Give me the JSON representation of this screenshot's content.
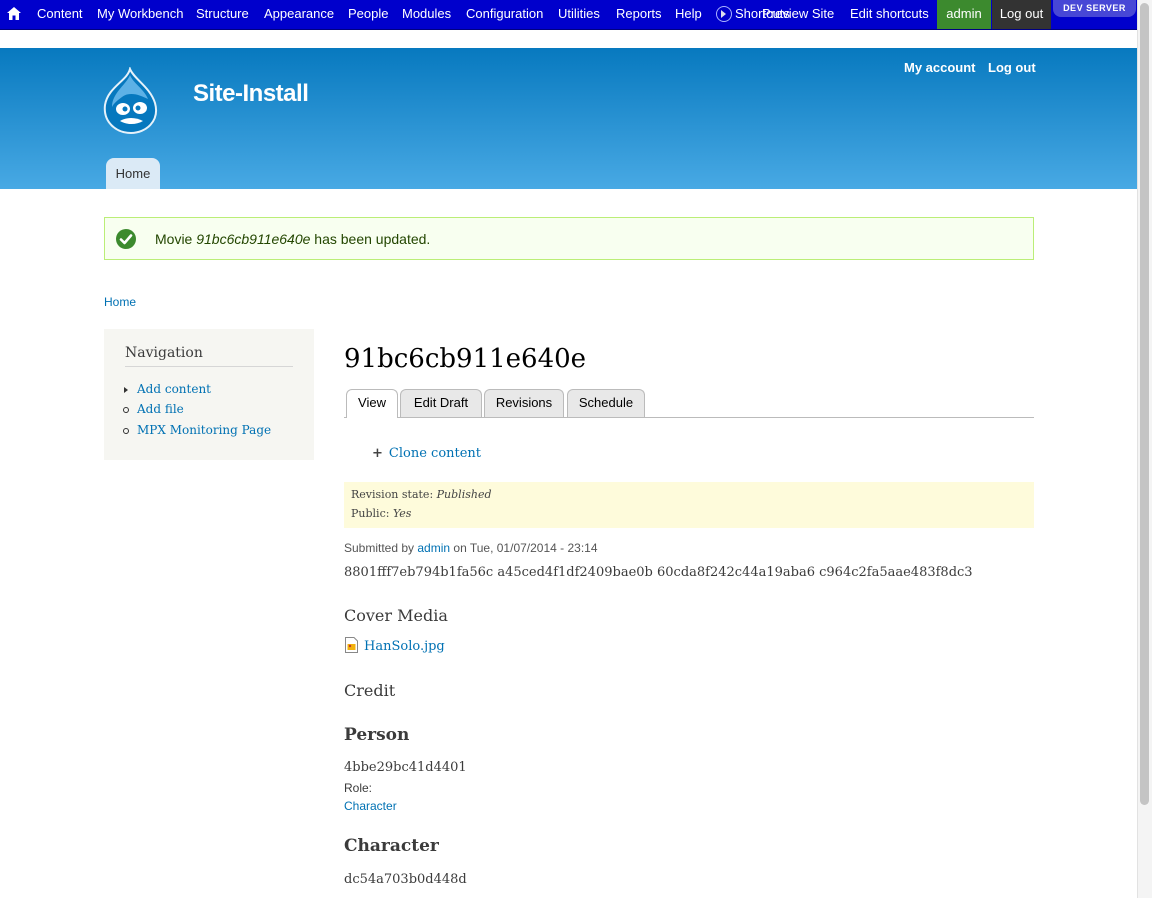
{
  "toolbar": {
    "items": [
      "Content",
      "My Workbench",
      "Structure",
      "Appearance",
      "People",
      "Modules",
      "Configuration",
      "Utilities",
      "Reports",
      "Help"
    ],
    "shortcuts_label": "Shortcuts",
    "preview_label": "Preview Site",
    "edit_shortcuts_label": "Edit shortcuts",
    "user_label": "admin",
    "logout_label": "Log out",
    "dev_badge": "DEV SERVER"
  },
  "header": {
    "site_name": "Site-Install",
    "my_account": "My account",
    "log_out": "Log out",
    "home_tab": "Home"
  },
  "message": {
    "prefix": "Movie ",
    "title": "91bc6cb911e640e",
    "suffix": " has been updated."
  },
  "breadcrumb": "Home",
  "sidebar": {
    "title": "Navigation",
    "items": [
      "Add content",
      "Add file",
      "MPX Monitoring Page"
    ]
  },
  "node": {
    "title": "91bc6cb911e640e",
    "tabs": [
      "View",
      "Edit Draft",
      "Revisions",
      "Schedule"
    ],
    "clone_label": "Clone content",
    "revision_state_label": "Revision state: ",
    "revision_state_value": "Published",
    "public_label": "Public: ",
    "public_value": "Yes",
    "submitted_prefix": "Submitted by ",
    "submitted_user": "admin",
    "submitted_suffix": " on Tue, 01/07/2014 - 23:14",
    "body": "8801fff7eb794b1fa56c a45ced4f1df2409bae0b 60cda8f242c44a19aba6 c964c2fa5aae483f8dc3",
    "cover_media_heading": "Cover Media",
    "cover_file": "HanSolo.jpg",
    "credit_heading": "Credit",
    "person_heading": "Person",
    "person_value": "4bbe29bc41d4401",
    "role_label": "Role:",
    "role_value": "Character",
    "character_heading": "Character",
    "character_value": "dc54a703b0d448d"
  },
  "colors": {
    "toolbar": "#0000cc",
    "header_top": "#0779bf",
    "header_bottom": "#48a9e4",
    "link": "#0071b3",
    "status_border": "#bbee77",
    "revision_bg": "#fefbdb"
  }
}
